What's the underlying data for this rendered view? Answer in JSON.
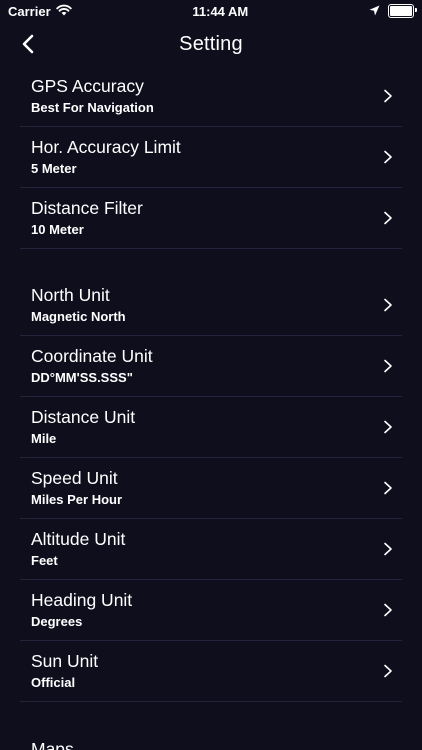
{
  "status_bar": {
    "carrier": "Carrier",
    "time": "11:44 AM",
    "icons": [
      "wifi-icon",
      "location-arrow-icon",
      "battery-icon"
    ]
  },
  "nav": {
    "title": "Setting",
    "back_icon": "chevron-left-icon"
  },
  "sections": [
    {
      "rows": [
        {
          "title": "GPS Accuracy",
          "value": "Best For Navigation"
        },
        {
          "title": "Hor. Accuracy Limit",
          "value": "5 Meter"
        },
        {
          "title": "Distance Filter",
          "value": "10 Meter"
        }
      ]
    },
    {
      "rows": [
        {
          "title": "North Unit",
          "value": "Magnetic North"
        },
        {
          "title": "Coordinate Unit",
          "value": "DD°MM'SS.SSS\""
        },
        {
          "title": "Distance Unit",
          "value": "Mile"
        },
        {
          "title": "Speed Unit",
          "value": "Miles Per Hour"
        },
        {
          "title": "Altitude Unit",
          "value": "Feet"
        },
        {
          "title": "Heading Unit",
          "value": "Degrees"
        },
        {
          "title": "Sun Unit",
          "value": "Official"
        }
      ]
    },
    {
      "rows": [
        {
          "title": "Maps"
        }
      ]
    }
  ],
  "colors": {
    "background": "#0f0e1d",
    "separator": "#24233a",
    "text": "#ffffff"
  }
}
